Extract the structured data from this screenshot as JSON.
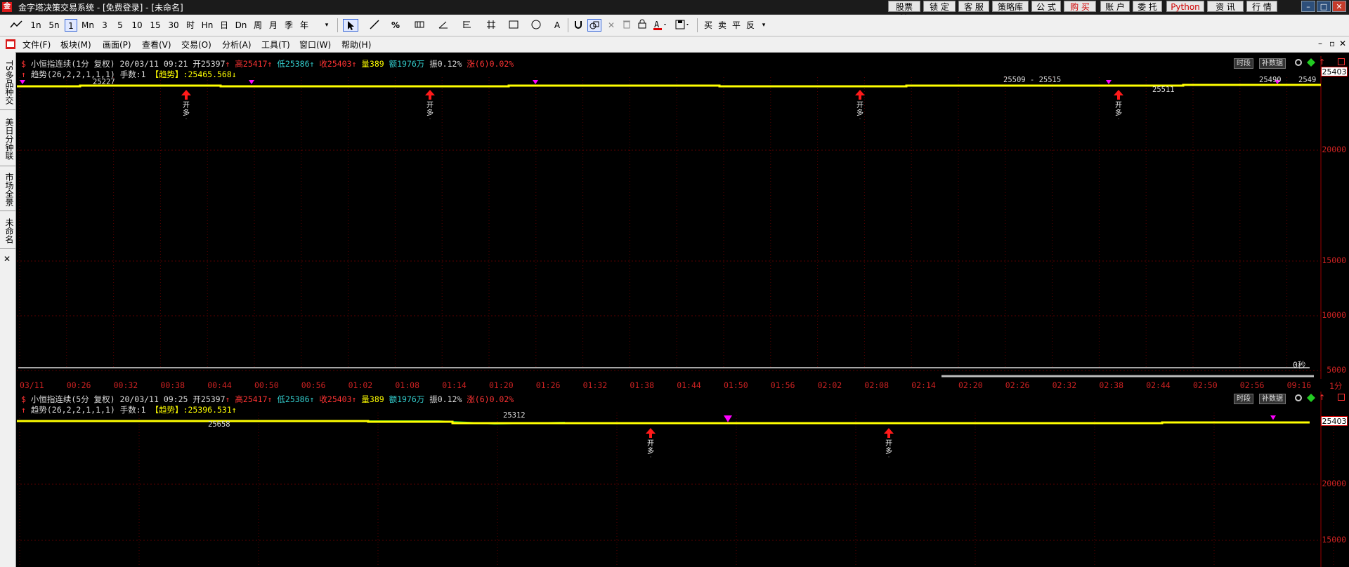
{
  "titlebar": {
    "app_icon_glyph": "金",
    "title": "金字塔决策交易系统 - [免费登录] - [未命名]",
    "buttons": [
      "股票池",
      "锁 定",
      "客 服",
      "策略库",
      "公 式",
      "购 买",
      "账 户",
      "委 托",
      "Python",
      "资 讯",
      "行 情"
    ],
    "red_buttons": [
      "购 买",
      "Python"
    ],
    "window_controls": [
      "–",
      "□",
      "✕"
    ]
  },
  "toolbar": {
    "periods": [
      "1n",
      "5n",
      "1",
      "Mn",
      "3",
      "5",
      "10",
      "15",
      "30",
      "时",
      "Hn",
      "日",
      "Dn",
      "周",
      "月",
      "季",
      "年"
    ],
    "selected_period": "1",
    "tools_text": [
      "A",
      "买",
      "卖",
      "平",
      "反"
    ]
  },
  "menubar": {
    "items": [
      "文件(F)",
      "板块(M)",
      "画面(P)",
      "查看(V)",
      "交易(O)",
      "分析(A)",
      "工具(T)",
      "窗口(W)",
      "帮助(H)"
    ],
    "right_controls": [
      "–",
      "▫",
      "✕"
    ]
  },
  "lefttabs": [
    "TS多品种交",
    "美日分钟联",
    "市场全景",
    "未命名",
    "✕"
  ],
  "panel_top": {
    "name": "小恒指连续(1分 复权)",
    "datetime": "20/03/11 09:21",
    "open": "开25397",
    "high": "高25417",
    "low": "低25386",
    "close": "收25403",
    "volume": "量389",
    "amount": "额1976万",
    "amplitude": "振0.12%",
    "change": "涨(6)0.02%",
    "indicator_name": "趋势(26,2,2,1,1,1)",
    "lots": "手数:1",
    "indicator_label": "【趋势】",
    "indicator_value": ":25465.568",
    "buttons": [
      "时段",
      "补数据"
    ],
    "last_price": "25403",
    "price_labels": [
      "25227",
      "25509 - 25515",
      "25511",
      "25490",
      "2549"
    ],
    "signals": [
      "开多",
      "开多",
      "开多",
      "开多"
    ],
    "seconds_label": "0秒",
    "y_axis": [
      "20000",
      "15000",
      "10000",
      "5000"
    ]
  },
  "time_axis": {
    "labels": [
      "03/11",
      "00:26",
      "00:32",
      "00:38",
      "00:44",
      "00:50",
      "00:56",
      "01:02",
      "01:08",
      "01:14",
      "01:20",
      "01:26",
      "01:32",
      "01:38",
      "01:44",
      "01:50",
      "01:56",
      "02:02",
      "02:08",
      "02:14",
      "02:20",
      "02:26",
      "02:32",
      "02:38",
      "02:44",
      "02:50",
      "02:56",
      "09:16"
    ],
    "period_label": "1分"
  },
  "panel_bottom": {
    "name": "小恒指连续(5分 复权)",
    "datetime": "20/03/11 09:25",
    "open": "开25397",
    "high": "高25417",
    "low": "低25386",
    "close": "收25403",
    "volume": "量389",
    "amount": "额1976万",
    "amplitude": "振0.12%",
    "change": "涨(6)0.02%",
    "indicator_name": "趋势(26,2,2,1,1,1)",
    "lots": "手数:1",
    "indicator_label": "【趋势】",
    "indicator_value": ":25396.531",
    "buttons": [
      "时段",
      "补数据"
    ],
    "last_price": "25403",
    "price_labels": [
      "25658",
      "25312"
    ],
    "signals": [
      "开多",
      "开多"
    ],
    "y_axis": [
      "20000",
      "15000"
    ]
  },
  "colors": {
    "up_red": "#ff3333",
    "down_cyan": "#33cccc",
    "trend_yellow": "#ffff00",
    "signal_magenta": "#ff00ff",
    "grid_red": "#5a0000"
  }
}
